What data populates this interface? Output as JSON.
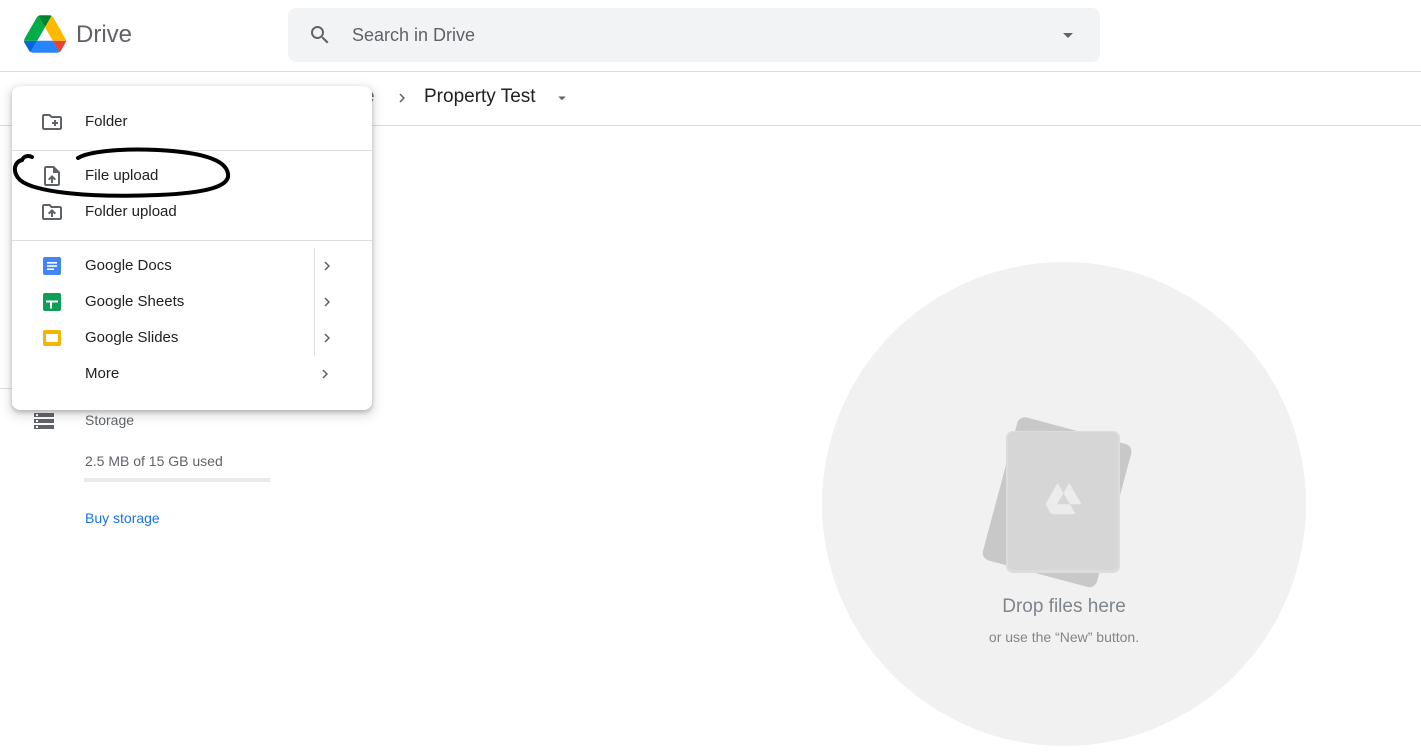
{
  "header": {
    "brand": "Drive",
    "search": {
      "placeholder": "Search in Drive"
    }
  },
  "breadcrumb": {
    "previous_fragment": "e",
    "current": "Property Test"
  },
  "new_menu": {
    "items": [
      {
        "label": "Folder",
        "icon": "new-folder-icon"
      },
      {
        "label": "File upload",
        "icon": "file-upload-icon"
      },
      {
        "label": "Folder upload",
        "icon": "folder-upload-icon"
      },
      {
        "label": "Google Docs",
        "icon": "google-docs-icon",
        "color": "#4285f4"
      },
      {
        "label": "Google Sheets",
        "icon": "google-sheets-icon",
        "color": "#0f9d58"
      },
      {
        "label": "Google Slides",
        "icon": "google-slides-icon",
        "color": "#f4b400"
      },
      {
        "label": "More"
      }
    ]
  },
  "sidebar": {
    "storage": {
      "label": "Storage",
      "used_text": "2.5 MB of 15 GB used",
      "used_fraction": 0.0002,
      "buy_label": "Buy storage"
    }
  },
  "empty_state": {
    "title": "Drop files here",
    "subtitle": "or use the “New” button."
  },
  "colors": {
    "accent": "#1a73e8",
    "annotation": "#000000"
  }
}
